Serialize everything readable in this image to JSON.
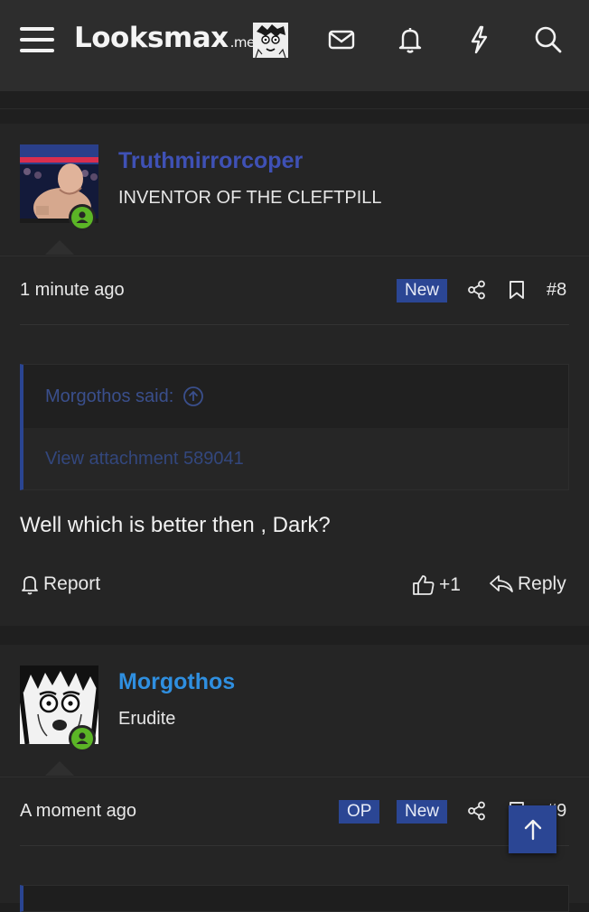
{
  "header": {
    "logo_text": "Lo oksmax",
    "logo_suffix": ".me",
    "icons": [
      "menu-icon",
      "mail-icon",
      "bell-icon",
      "bolt-icon",
      "search-icon"
    ]
  },
  "posts": [
    {
      "username": "Truthmirrorcoper",
      "username_color": "#3f51b5",
      "user_title": "INVENTOR OF THE CLEFTPILL",
      "timestamp": "1 minute ago",
      "badges": [
        "New"
      ],
      "post_number": "#8",
      "quote": {
        "author_line": "Morgothos said:",
        "content": "View attachment 589041"
      },
      "message": "Well which is better then , Dark?",
      "actions": {
        "report": "Report",
        "like_count": "+1",
        "reply": "Reply"
      }
    },
    {
      "username": "Morgothos",
      "username_color": "#2f8fe0",
      "user_title": "Erudite",
      "timestamp": "A moment ago",
      "badges": [
        "OP",
        "New"
      ],
      "post_number": "#9"
    }
  ],
  "colors": {
    "badge_bg": "#2b4694",
    "online": "#5bb526",
    "background": "#1f1f1f",
    "post_background": "#252525"
  }
}
